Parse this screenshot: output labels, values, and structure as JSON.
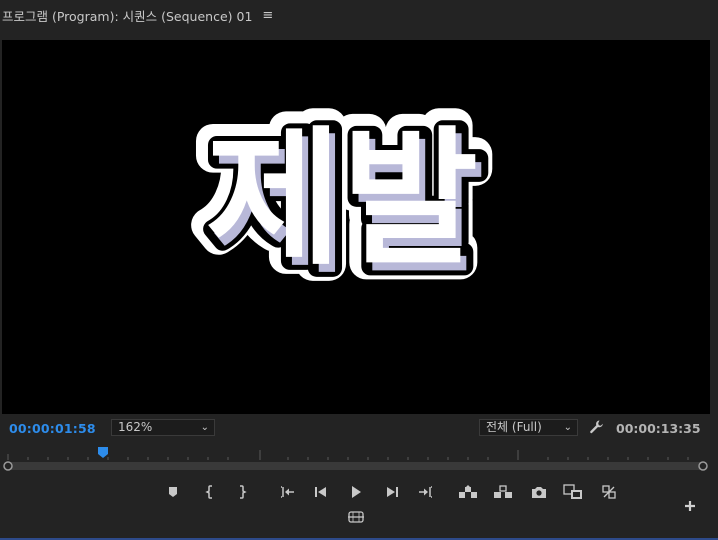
{
  "panel": {
    "title": "프로그램 (Program): 시퀀스 (Sequence) 01",
    "menu_icon": "hamburger-menu-icon"
  },
  "viewer": {
    "caption_text": "제발",
    "background": "#000000",
    "text_fill": "#ffffff",
    "text_shadow": "#b8b8d8",
    "text_outline": "#000000"
  },
  "controls": {
    "current_timecode": "00:00:01:58",
    "zoom_level": "162%",
    "resolution": "전체 (Full)",
    "duration_timecode": "00:00:13:35",
    "timecode_color": "#2d8ceb"
  },
  "transport": {
    "buttons": [
      "add-marker-icon",
      "mark-in-icon",
      "mark-out-icon",
      "go-to-in-icon",
      "step-back-icon",
      "play-icon",
      "step-forward-icon",
      "go-to-out-icon",
      "lift-icon",
      "extract-icon",
      "export-frame-icon",
      "comparison-view-icon",
      "toggle-proxies-icon",
      "vr-video-icon",
      "button-editor-icon"
    ]
  }
}
